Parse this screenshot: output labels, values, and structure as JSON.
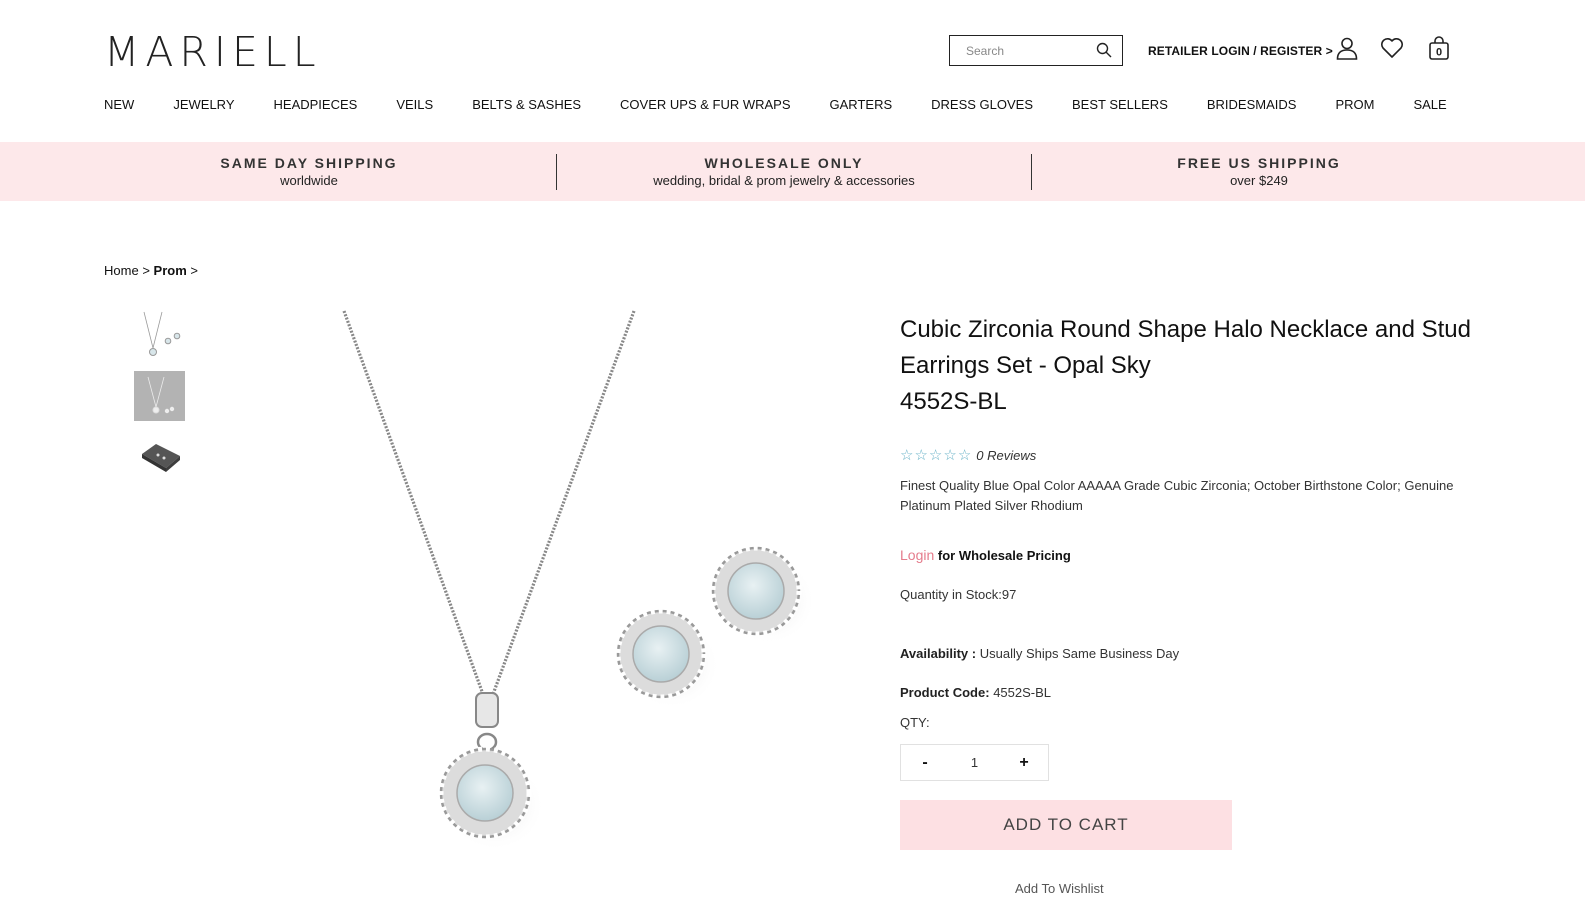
{
  "header": {
    "logo": "MARIELL",
    "search_placeholder": "Search",
    "retailer_login": "RETAILER LOGIN / REGISTER >",
    "cart_count": "0"
  },
  "nav": [
    "NEW",
    "JEWELRY",
    "HEADPIECES",
    "VEILS",
    "BELTS & SASHES",
    "COVER UPS & FUR WRAPS",
    "GARTERS",
    "DRESS GLOVES",
    "BEST SELLERS",
    "BRIDESMAIDS",
    "PROM",
    "SALE"
  ],
  "promo": [
    {
      "title": "SAME DAY SHIPPING",
      "sub": "worldwide"
    },
    {
      "title": "WHOLESALE ONLY",
      "sub": "wedding, bridal & prom jewelry & accessories"
    },
    {
      "title": "FREE US SHIPPING",
      "sub": "over $249"
    }
  ],
  "breadcrumb": {
    "home": "Home",
    "sep": ">",
    "current": "Prom"
  },
  "product": {
    "title": "Cubic Zirconia Round Shape Halo Necklace and Stud Earrings Set - Opal Sky",
    "sku": "4552S-BL",
    "rating": 0,
    "reviews": "0 Reviews",
    "description": "Finest Quality Blue Opal Color AAAAA Grade Cubic Zirconia; October Birthstone Color; Genuine Platinum Plated Silver Rhodium",
    "login_link": "Login",
    "login_text": " for Wholesale Pricing",
    "stock": "Quantity in Stock:97",
    "availability_label": "Availability :",
    "availability_value": "Usually Ships Same Business Day",
    "code_label": "Product Code:",
    "code_value": "4552S-BL",
    "qty_label": "QTY:",
    "qty_value": "1",
    "minus": "-",
    "plus": "+",
    "add_to_cart": "ADD TO CART",
    "add_to_wishlist": "Add To Wishlist"
  },
  "colors": {
    "promo_bg": "#fde8ea",
    "cart_bg": "#fde0e3",
    "login_link": "#e57c8c",
    "star": "#6ab3c8"
  }
}
